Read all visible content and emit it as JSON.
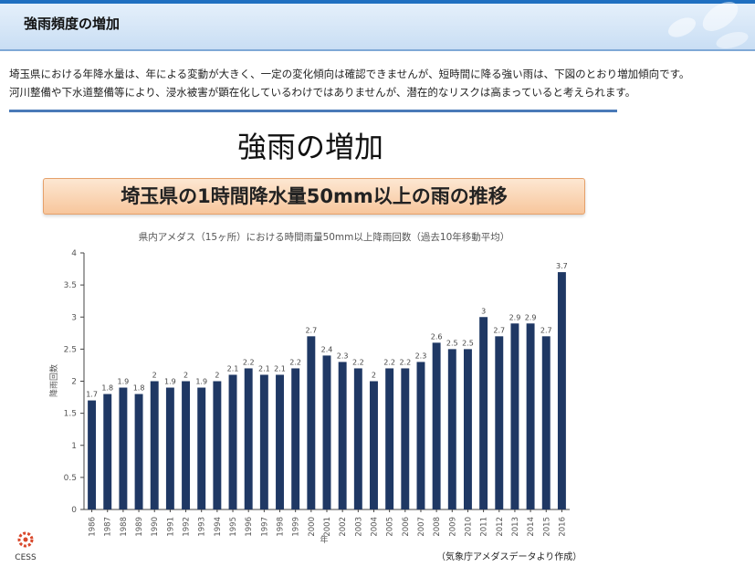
{
  "header": {
    "title": "強雨頻度の増加"
  },
  "intro": {
    "line1": "埼玉県における年降水量は、年による変動が大きく、一定の変化傾向は確認できませんが、短時間に降る強い雨は、下図のとおり増加傾向です。",
    "line2": "河川整備や下水道整備等により、浸水被害が顕在化しているわけではありませんが、潜在的なリスクは高まっていると考えられます。"
  },
  "slide": {
    "title": "強雨の増加",
    "subtitle": "埼玉県の1時間降水量50mm以上の雨の推移"
  },
  "logo": {
    "text": "CESS"
  },
  "source": "（気象庁アメダスデータより作成）",
  "colors": {
    "bar": "#1f3864",
    "header_accent": "#1f6fc0",
    "divider": "#4a7ab8"
  },
  "chart_data": {
    "type": "bar",
    "title": "県内アメダス（15ヶ所）における時間雨量50mm以上降雨回数（過去10年移動平均）",
    "xlabel": "年",
    "ylabel": "降雨回数",
    "ylim": [
      0,
      4
    ],
    "yticks": [
      "0",
      "0.5",
      "1",
      "1.5",
      "2",
      "2.5",
      "3",
      "3.5",
      "4"
    ],
    "grid": false,
    "categories": [
      "1986",
      "1987",
      "1988",
      "1989",
      "1990",
      "1991",
      "1992",
      "1993",
      "1994",
      "1995",
      "1996",
      "1997",
      "1998",
      "1999",
      "2000",
      "2001",
      "2002",
      "2003",
      "2004",
      "2005",
      "2006",
      "2007",
      "2008",
      "2009",
      "2010",
      "2011",
      "2012",
      "2013",
      "2014",
      "2015",
      "2016"
    ],
    "values": [
      1.7,
      1.8,
      1.9,
      1.8,
      2,
      1.9,
      2,
      1.9,
      2,
      2.1,
      2.2,
      2.1,
      2.1,
      2.2,
      2.7,
      2.4,
      2.3,
      2.2,
      2,
      2.2,
      2.2,
      2.3,
      2.6,
      2.5,
      2.5,
      3,
      2.7,
      2.9,
      2.9,
      2.7,
      3.7
    ]
  }
}
